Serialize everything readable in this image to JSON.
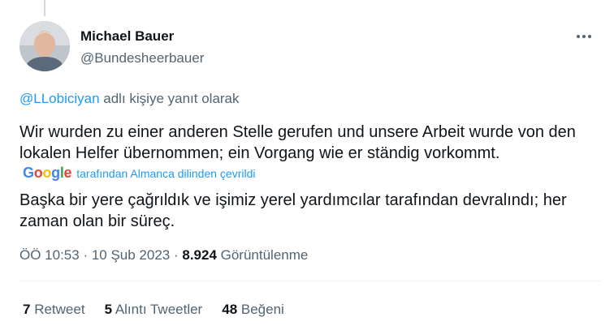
{
  "author": {
    "name": "Michael Bauer",
    "handle": "@Bundesheerbauer"
  },
  "reply": {
    "mention": "@LLobiciyan",
    "suffix": " adlı kişiye yanıt olarak"
  },
  "tweet": {
    "text": "Wir wurden zu einer anderen Stelle gerufen und unsere Arbeit wurde von den lokalen Helfer übernommen; ein Vorgang wie er ständig vorkommt.",
    "translation_label": "tarafından Almanca dilinden çevrildi",
    "translated_text": "Başka bir yere çağrıldık ve işimiz yerel yardımcılar tarafından devralındı; her zaman olan bir süreç."
  },
  "meta": {
    "time": "ÖÖ 10:53",
    "sep1": " · ",
    "date": "10 Şub 2023",
    "sep2": " · ",
    "views_count": "8.924",
    "views_label": " Görüntülenme"
  },
  "stats": {
    "retweets_count": "7",
    "retweets_label": " Retweet",
    "quotes_count": "5",
    "quotes_label": " Alıntı Tweetler",
    "likes_count": "48",
    "likes_label": " Beğeni"
  },
  "icons": {
    "more": "more-horizontal-icon",
    "google": "google-logo"
  },
  "colors": {
    "link": "#1d9bf0",
    "secondary_text": "#536471",
    "primary_text": "#0f1419"
  }
}
